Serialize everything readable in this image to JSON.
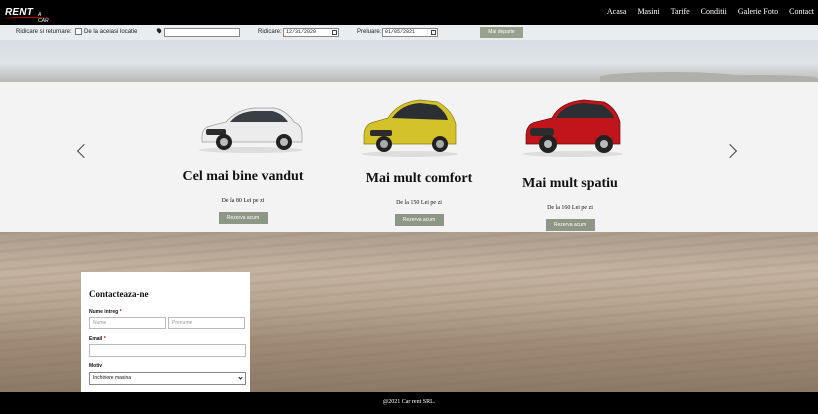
{
  "navbar": {
    "logo_main": "RENT",
    "logo_sub": "A   CAR",
    "links": [
      "Acasa",
      "Masini",
      "Tarife",
      "Conditii",
      "Galerie Foto",
      "Contact"
    ]
  },
  "search": {
    "pickup_return_label": "Ridicare si returnare:",
    "same_location_label": "De la aceiasi locatie",
    "location_value": "",
    "pickup_label": "Ridicare:",
    "pickup_date": "12/31/2020",
    "return_label": "Preluare:",
    "return_date": "01/05/2021",
    "submit_label": "Mai departe"
  },
  "carousel": {
    "slides": [
      {
        "title": "Cel mai bine vandut",
        "price": "De la 80 Lei pe zi",
        "button": "Rezerva acum",
        "car_color": "#e9e9e9"
      },
      {
        "title": "Mai mult comfort",
        "price": "De la 150 Lei pe zi",
        "button": "Rezerva acum",
        "car_color": "#d4c22a"
      },
      {
        "title": "Mai mult spatiu",
        "price": "De la 160 Lei pe zi",
        "button": "Rezerva acum",
        "car_color": "#c0151b"
      }
    ]
  },
  "contact": {
    "title": "Contacteaza-ne",
    "name_label": "Nume intreg",
    "name_placeholder": "Nume",
    "surname_placeholder": "Prenume",
    "email_label": "Email",
    "email_value": "",
    "reason_label": "Motiv",
    "reason_selected": "Inchiriere masina"
  },
  "footer": {
    "text": "@2021 Car rent SRL."
  },
  "colors": {
    "nav_bg": "#000000",
    "button_bg": "#8e9685",
    "required_mark": "#cc0000"
  }
}
